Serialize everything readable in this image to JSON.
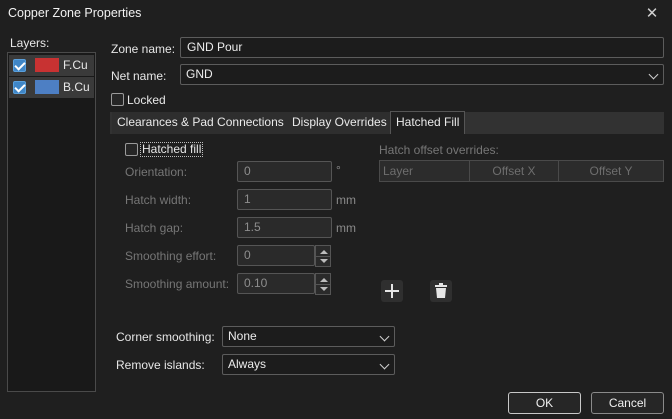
{
  "window": {
    "title": "Copper Zone Properties",
    "close_glyph": "✕"
  },
  "layers": {
    "label": "Layers:",
    "items": [
      {
        "name": "F.Cu",
        "checked": true,
        "color": "#c83232"
      },
      {
        "name": "B.Cu",
        "checked": true,
        "color": "#4d7fc4"
      }
    ]
  },
  "zone": {
    "name_label": "Zone name:",
    "name_value": "GND Pour",
    "net_label": "Net name:",
    "net_value": "GND",
    "locked_label": "Locked",
    "locked": false
  },
  "tabs": [
    {
      "label": "Clearances & Pad Connections",
      "active": false
    },
    {
      "label": "Display Overrides",
      "active": false
    },
    {
      "label": "Hatched Fill",
      "active": true
    }
  ],
  "hatch": {
    "checkbox_label": "Hatched fill",
    "checked": false,
    "orientation_label": "Orientation:",
    "orientation_value": "0",
    "orientation_unit": "°",
    "width_label": "Hatch width:",
    "width_value": "1",
    "width_unit": "mm",
    "gap_label": "Hatch gap:",
    "gap_value": "1.5",
    "gap_unit": "mm",
    "effort_label": "Smoothing effort:",
    "effort_value": "0",
    "amount_label": "Smoothing amount:",
    "amount_value": "0.10"
  },
  "offsets": {
    "title": "Hatch offset overrides:",
    "columns": [
      "Layer",
      "Offset X",
      "Offset Y"
    ],
    "add_icon": "plus-icon",
    "delete_icon": "trash-icon"
  },
  "bottom": {
    "corner_label": "Corner smoothing:",
    "corner_value": "None",
    "islands_label": "Remove islands:",
    "islands_value": "Always"
  },
  "buttons": {
    "ok": "OK",
    "cancel": "Cancel"
  },
  "colors": {
    "accent": "#3f86c7",
    "background": "#1f1f1f"
  }
}
